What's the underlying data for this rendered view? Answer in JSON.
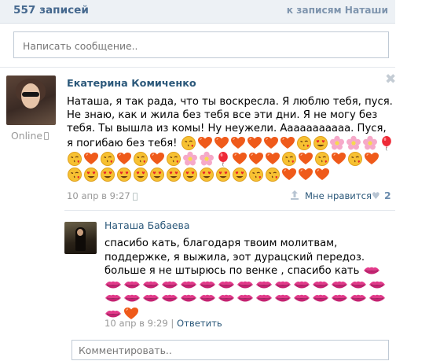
{
  "header": {
    "count_label": "557 записей",
    "link_label": "к записям Наташи"
  },
  "compose": {
    "placeholder": "Написать сообщение.."
  },
  "post": {
    "author": "Екатерина Комиченко",
    "online_label": "Online",
    "text": "Наташа, я так рада, что ты воскресла. Я люблю тебя, пуся. Не знаю, как и жила без тебя все эти дни. Я не могу без тебя. Ты вышла из комы! Ну неужели. Ааааааааааа. Пуся, я погибаю без тебя!",
    "emoji": [
      "kiss-face",
      "heart",
      "heart",
      "heart",
      "heart",
      "heart",
      "heart",
      "kiss-face",
      "heart-eyes",
      "blossom",
      "blossom",
      "blossom",
      "balloon",
      "kiss-face",
      "heart",
      "kiss-face",
      "heart",
      "kiss-face",
      "heart",
      "kiss-face",
      "blossom",
      "blossom",
      "balloon",
      "heart",
      "heart",
      "heart",
      "kiss-face",
      "heart",
      "kiss-face",
      "heart",
      "kiss-face",
      "heart",
      "kiss-face",
      "heart-eyes",
      "heart-eyes",
      "heart-eyes",
      "heart-eyes",
      "heart-eyes",
      "heart-eyes",
      "heart-eyes",
      "heart-eyes",
      "heart-eyes",
      "heart-eyes",
      "kiss-face",
      "kiss-face",
      "heart",
      "heart",
      "heart"
    ],
    "date": "10 апр в 9:27",
    "like_label": "Мне нравится",
    "like_count": "2"
  },
  "reply": {
    "author": "Наташа Бабаева",
    "text": "спасибо кать, благодаря твоим молитвам, поддержке, я выжила, эот дурацский передоз. больше я не штырюсь по венке , спасибо кать",
    "kiss_count": 32,
    "date": "10 апр в 9:29",
    "separator": "|",
    "reply_label": "Ответить"
  },
  "comment": {
    "placeholder": "Комментировать.."
  },
  "colors": {
    "link": "#2b587a",
    "header_bg": "#edf1f5",
    "muted": "#999999"
  }
}
